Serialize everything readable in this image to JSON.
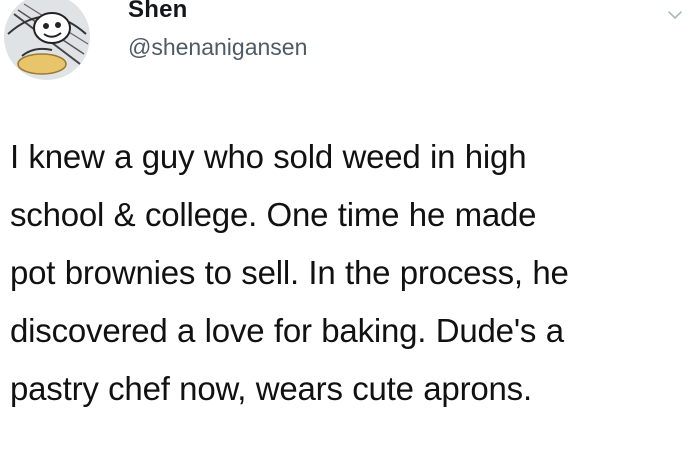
{
  "tweet": {
    "display_name": "Shen",
    "handle": "@shenanigansen",
    "text_lines": [
      "I knew a guy who sold weed in high",
      "school & college. One time he made",
      "pot brownies to sell. In the process, he",
      "discovered a love for baking. Dude's a",
      "pastry chef now, wears cute aprons."
    ]
  },
  "icons": {
    "avatar": "avatar-image",
    "menu": "chevron-down-icon"
  },
  "colors": {
    "name": "#14171a",
    "handle": "#4e5a64",
    "chevron": "#aab8c2",
    "background": "#ffffff"
  }
}
